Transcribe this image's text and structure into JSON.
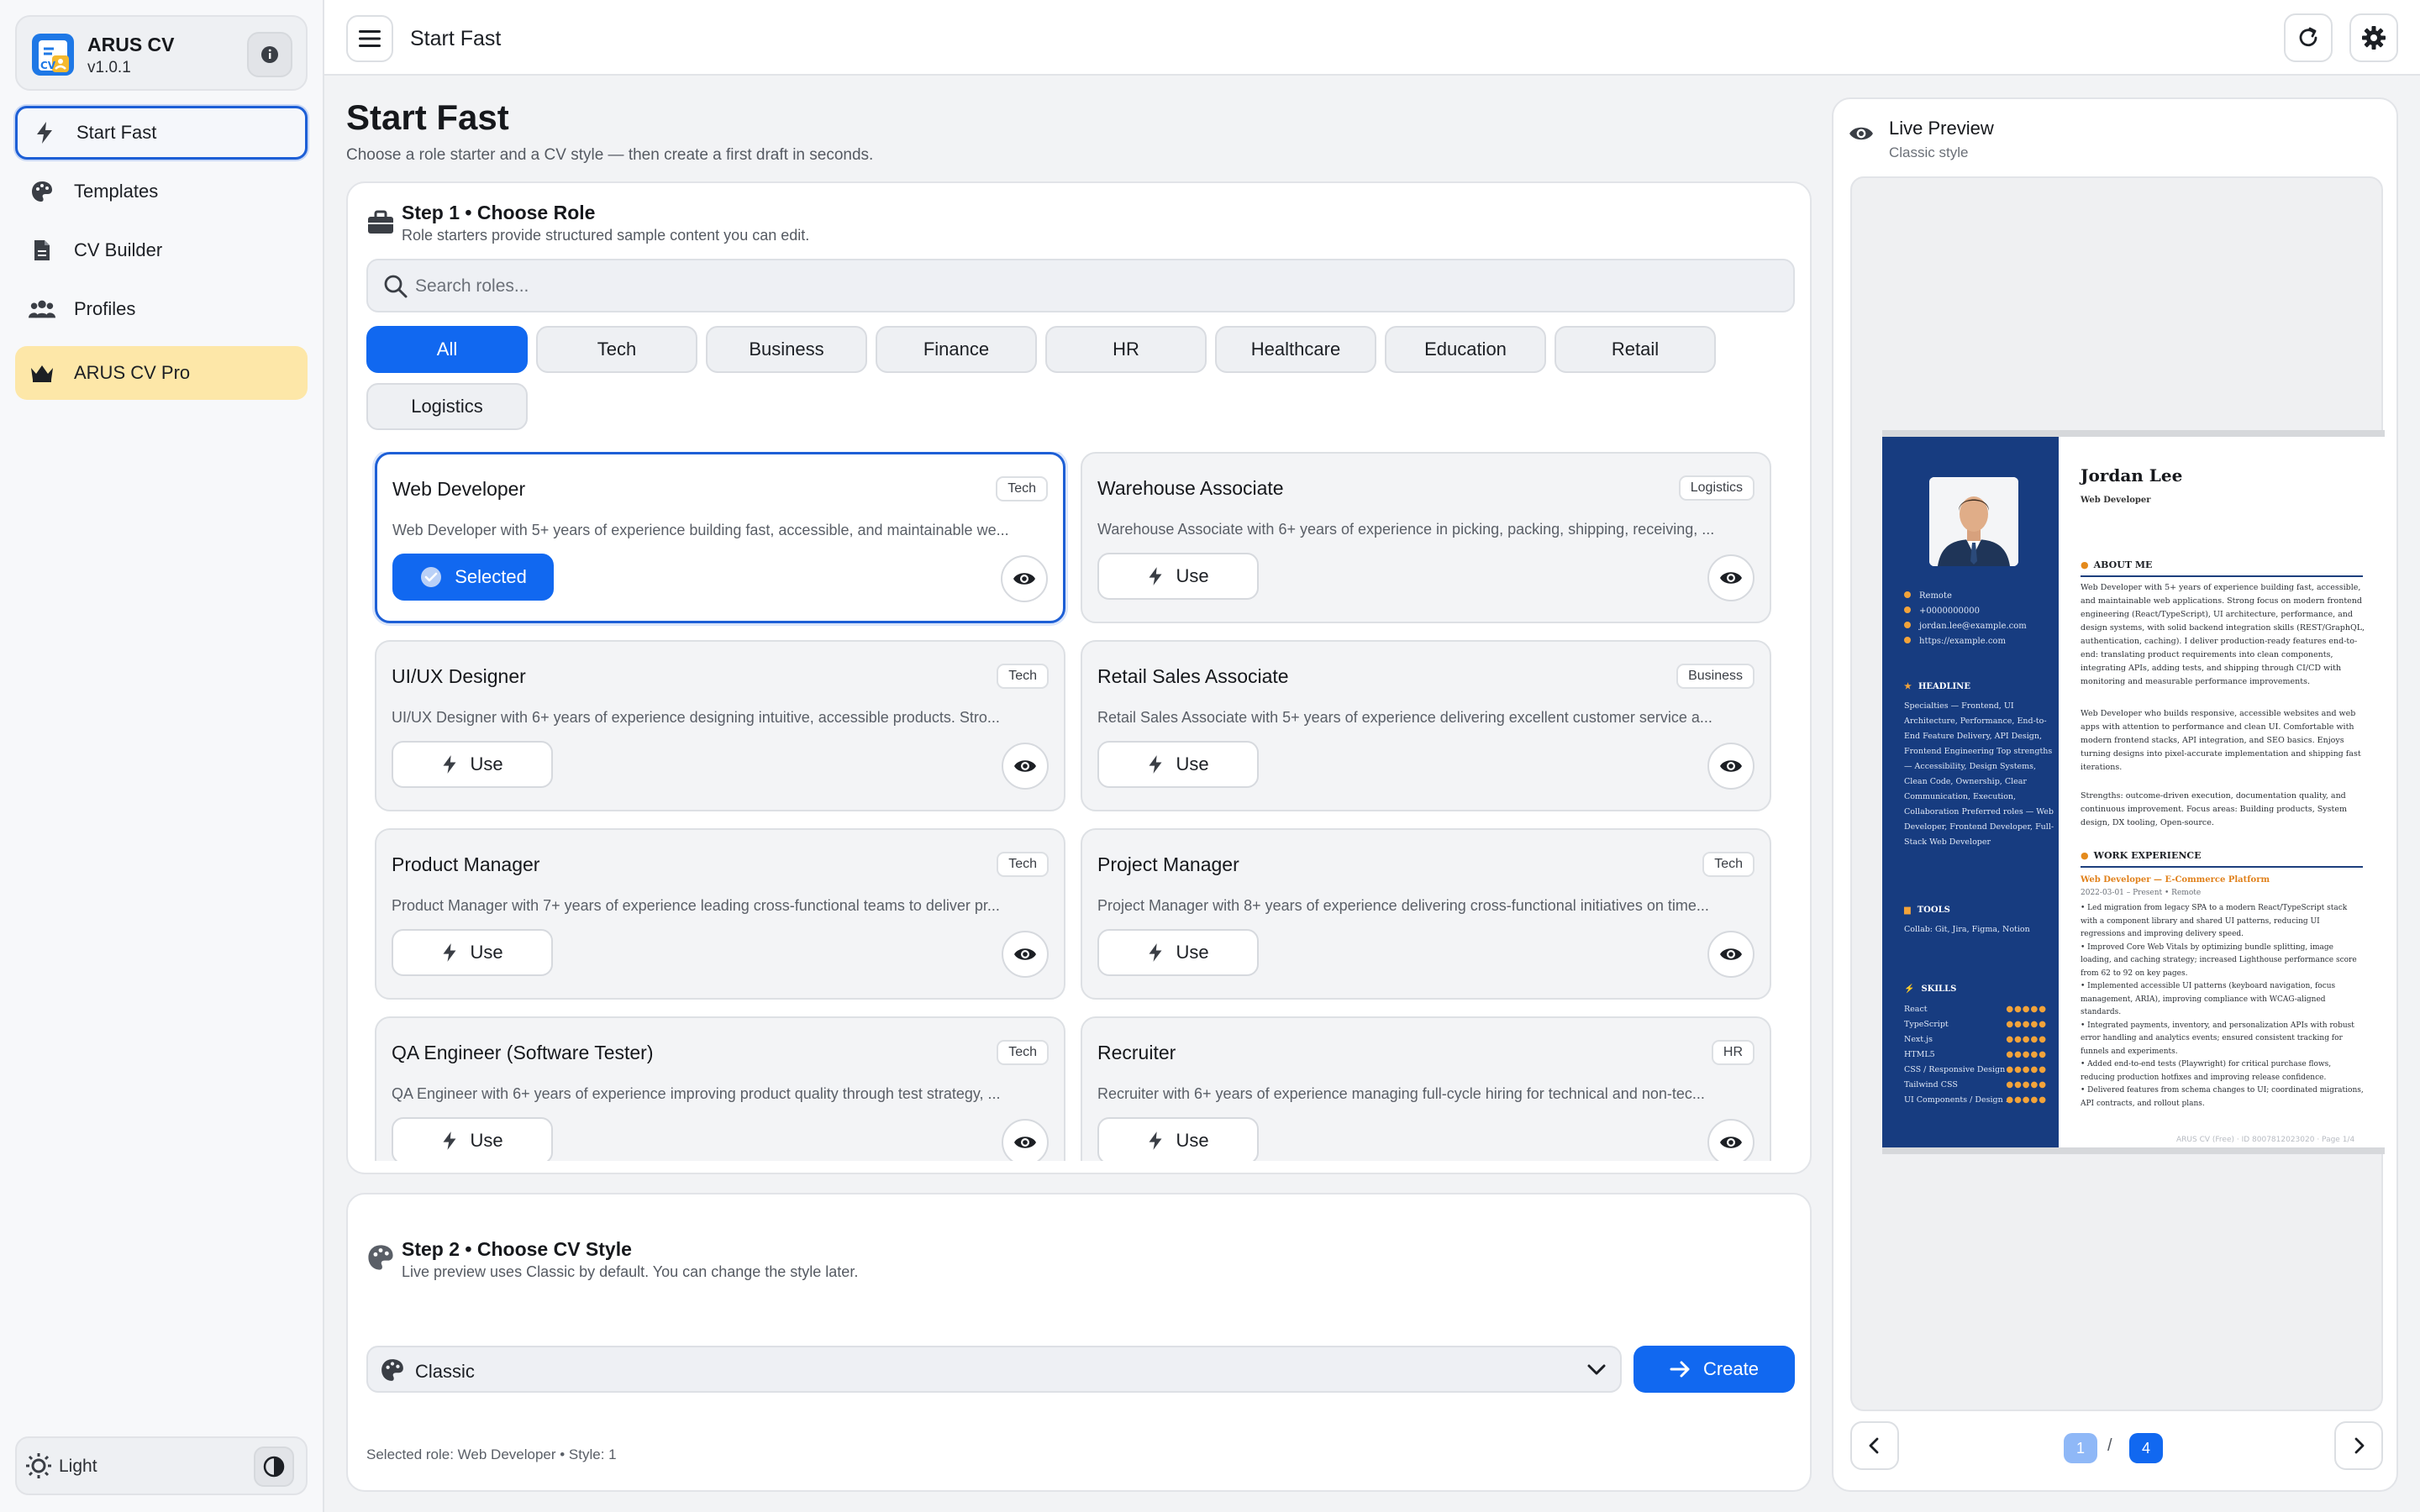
{
  "app": {
    "name": "ARUS CV",
    "version": "v1.0.1"
  },
  "sidebar": {
    "items": [
      {
        "label": "Start Fast",
        "icon": "bolt-icon",
        "active": true
      },
      {
        "label": "Templates",
        "icon": "palette-icon"
      },
      {
        "label": "CV Builder",
        "icon": "document-icon"
      },
      {
        "label": "Profiles",
        "icon": "people-icon"
      },
      {
        "label": "ARUS CV Pro",
        "icon": "crown-icon"
      }
    ],
    "theme_label": "Light"
  },
  "topbar": {
    "title": "Start Fast"
  },
  "page": {
    "title": "Start Fast",
    "subtitle": "Choose a role starter and a CV style — then create a first draft in seconds."
  },
  "step1": {
    "title": "Step 1 • Choose Role",
    "subtitle": "Role starters provide structured sample content you can edit.",
    "search_placeholder": "Search roles...",
    "categories": [
      "All",
      "Tech",
      "Business",
      "Finance",
      "HR",
      "Healthcare",
      "Education",
      "Retail",
      "Logistics"
    ],
    "active_category": "All",
    "selected_label": "Selected",
    "use_label": "Use",
    "roles": [
      {
        "title": "Web Developer",
        "tag": "Tech",
        "desc": "Web Developer with 5+ years of experience building fast, accessible, and maintainable we...",
        "selected": true
      },
      {
        "title": "Warehouse Associate",
        "tag": "Logistics",
        "desc": "Warehouse Associate with 6+ years of experience in picking, packing, shipping, receiving, ..."
      },
      {
        "title": "UI/UX Designer",
        "tag": "Tech",
        "desc": "UI/UX Designer with 6+ years of experience designing intuitive, accessible products. Stro..."
      },
      {
        "title": "Retail Sales Associate",
        "tag": "Business",
        "desc": "Retail Sales Associate with 5+ years of experience delivering excellent customer service a..."
      },
      {
        "title": "Product Manager",
        "tag": "Tech",
        "desc": "Product Manager with 7+ years of experience leading cross-functional teams to deliver pr..."
      },
      {
        "title": "Project Manager",
        "tag": "Tech",
        "desc": "Project Manager with 8+ years of experience delivering cross-functional initiatives on time..."
      },
      {
        "title": "QA Engineer (Software Tester)",
        "tag": "Tech",
        "desc": "QA Engineer with 6+ years of experience improving product quality through test strategy, ..."
      },
      {
        "title": "Recruiter",
        "tag": "HR",
        "desc": "Recruiter with 6+ years of experience managing full-cycle hiring for technical and non-tec..."
      }
    ]
  },
  "step2": {
    "title": "Step 2 • Choose CV Style",
    "subtitle": "Live preview uses Classic by default. You can change the style later.",
    "style_value": "Classic",
    "create_label": "Create",
    "status": "Selected role: Web Developer • Style: 1"
  },
  "preview": {
    "title": "Live Preview",
    "subtitle": "Classic style",
    "page_current": "1",
    "page_separator": "/",
    "page_total": "4",
    "cv": {
      "name": "Jordan Lee",
      "role": "Web Developer",
      "contacts": [
        "Remote",
        "+0000000000",
        "jordan.lee@example.com",
        "https://example.com"
      ],
      "headline_title": "HEADLINE",
      "headline_text": "Specialties — Frontend, UI Architecture, Performance, End-to-End Feature Delivery, API Design, Frontend Engineering Top strengths — Accessibility, Design Systems, Clean Code, Ownership, Clear Communication, Execution, Collaboration Preferred roles — Web Developer, Frontend Developer, Full-Stack Web Developer",
      "tools_title": "TOOLS",
      "tools_text": "Collab: Git, Jira, Figma, Notion",
      "skills_title": "SKILLS",
      "skills": [
        "React",
        "TypeScript",
        "Next.js",
        "HTML5",
        "CSS / Responsive Design",
        "Tailwind CSS",
        "UI Components / Design ..."
      ],
      "skill_dots": "●●●●●",
      "about_title": "ABOUT ME",
      "about_p1": "Web Developer with 5+ years of experience building fast, accessible, and maintainable web applications. Strong focus on modern frontend engineering (React/TypeScript), UI architecture, performance, and design systems, with solid backend integration skills (REST/GraphQL, authentication, caching). I deliver production-ready features end-to-end: translating product requirements into clean components, integrating APIs, adding tests, and shipping through CI/CD with monitoring and measurable performance improvements.",
      "about_p2": "Web Developer who builds responsive, accessible websites and web apps with attention to performance and clean UI. Comfortable with modern frontend stacks, API integration, and SEO basics. Enjoys turning designs into pixel-accurate implementation and shipping fast iterations.",
      "about_p3": "Strengths: outcome-driven execution, documentation quality, and continuous improvement. Focus areas: Building products, System design, DX tooling, Open-source.",
      "work_title": "WORK EXPERIENCE",
      "job_title": "Web Developer — E-Commerce Platform",
      "job_date": "2022-03-01 – Present • Remote",
      "job_bullets": "• Led migration from legacy SPA to a modern React/TypeScript stack with a component library and shared UI patterns, reducing UI regressions and improving delivery speed.\n• Improved Core Web Vitals by optimizing bundle splitting, image loading, and caching strategy; increased Lighthouse performance score from 62 to 92 on key pages.\n• Implemented accessible UI patterns (keyboard navigation, focus management, ARIA), improving compliance with WCAG-aligned standards.\n• Integrated payments, inventory, and personalization APIs with robust error handling and analytics events; ensured consistent tracking for funnels and experiments.\n• Added end-to-end tests (Playwright) for critical purchase flows, reducing production hotfixes and improving release confidence.\n• Delivered features from schema changes to UI; coordinated migrations, API contracts, and rollout plans.",
      "footer": "ARUS CV (Free) · ID 8007812023020 · Page 1/4"
    }
  },
  "colors": {
    "accent": "#1168f0",
    "pro_bg": "#fde7a8",
    "cv_sidebar": "#173c80",
    "cv_accent": "#e0801a"
  }
}
